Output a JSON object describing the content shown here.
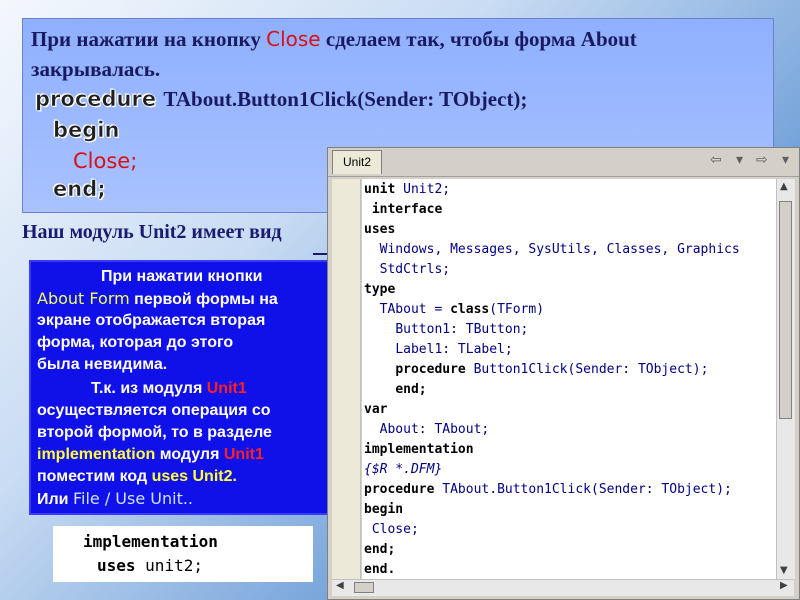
{
  "heading": {
    "part1": "При нажатии на кнопку",
    "close_word": "Close",
    "part2": "сделаем так, чтобы форма About",
    "line2": "закрывалась."
  },
  "snippet": {
    "procedure_kw": "procedure",
    "signature": "TAbout.Button1Click(Sender: TObject);",
    "begin_kw": "begin",
    "close_stmt": "Close;",
    "end_kw": "end;"
  },
  "module_title": "Наш модуль Unit2 имеет вид",
  "explain": {
    "l1": "При  нажатии кнопки",
    "l2_a": "About Form",
    "l2_b": "первой формы на",
    "l3": "экране отображается вторая",
    "l4": "форма, которая до этого",
    "l5": "была невидима.",
    "l6_a": "Т.к.  из  модуля",
    "l6_b": "Unit1",
    "l7": "осуществляется операция со",
    "l8": "второй формой, то в разделе",
    "l9_a": "implementation",
    "l9_b": "модуля",
    "l9_c": "Unit1",
    "l10_a": "поместим  код",
    "l10_b": "uses Unit2.",
    "l11_a": "Или",
    "l11_b": "File / Use Unit.."
  },
  "impl_box": {
    "line1": "implementation",
    "uses_kw": "uses",
    "unit": "unit2;"
  },
  "editor": {
    "tab_label": "Unit2",
    "nav_back": "⇦",
    "nav_dropdown": "▾",
    "nav_forward": "⇨",
    "nav_dropdown2": "▾",
    "code": [
      {
        "kw": "unit",
        "rest": " Unit2;",
        "indent": ""
      },
      {
        "kw": "interface",
        "rest": "",
        "indent": " "
      },
      {
        "kw": "uses",
        "rest": "",
        "indent": ""
      },
      {
        "kw": "",
        "rest": "Windows, Messages, SysUtils, Classes, Graphics",
        "indent": "  "
      },
      {
        "kw": "",
        "rest": "StdCtrls;",
        "indent": "  "
      },
      {
        "kw": "type",
        "rest": "",
        "indent": ""
      },
      {
        "kw": "",
        "rest": "TAbout = ",
        "indent": "  ",
        "kw2": "class",
        "rest2": "(TForm)"
      },
      {
        "kw": "",
        "rest": "Button1: TButton;",
        "indent": "    "
      },
      {
        "kw": "",
        "rest": "Label1: TLabel;",
        "indent": "    "
      },
      {
        "kw": "procedure",
        "rest": " Button1Click(Sender: TObject);",
        "indent": "    "
      },
      {
        "kw": "end;",
        "rest": "",
        "indent": "    "
      },
      {
        "kw": "var",
        "rest": "",
        "indent": ""
      },
      {
        "kw": "",
        "rest": "About: TAbout;",
        "indent": "  "
      },
      {
        "kw": "implementation",
        "rest": "",
        "indent": ""
      },
      {
        "kw": "",
        "rest": "{$R *.DFM}",
        "indent": "",
        "comment": true
      },
      {
        "kw": "procedure",
        "rest": " TAbout.Button1Click(Sender: TObject);",
        "indent": ""
      },
      {
        "kw": "begin",
        "rest": "",
        "indent": ""
      },
      {
        "kw": "",
        "rest": "Close;",
        "indent": " "
      },
      {
        "kw": "end;",
        "rest": "",
        "indent": ""
      },
      {
        "kw": "end.",
        "rest": "",
        "indent": ""
      }
    ]
  },
  "colors": {
    "accent_red": "#d8101a",
    "panel_blue": "#1010e8",
    "heading_navy": "#1a1a60"
  }
}
